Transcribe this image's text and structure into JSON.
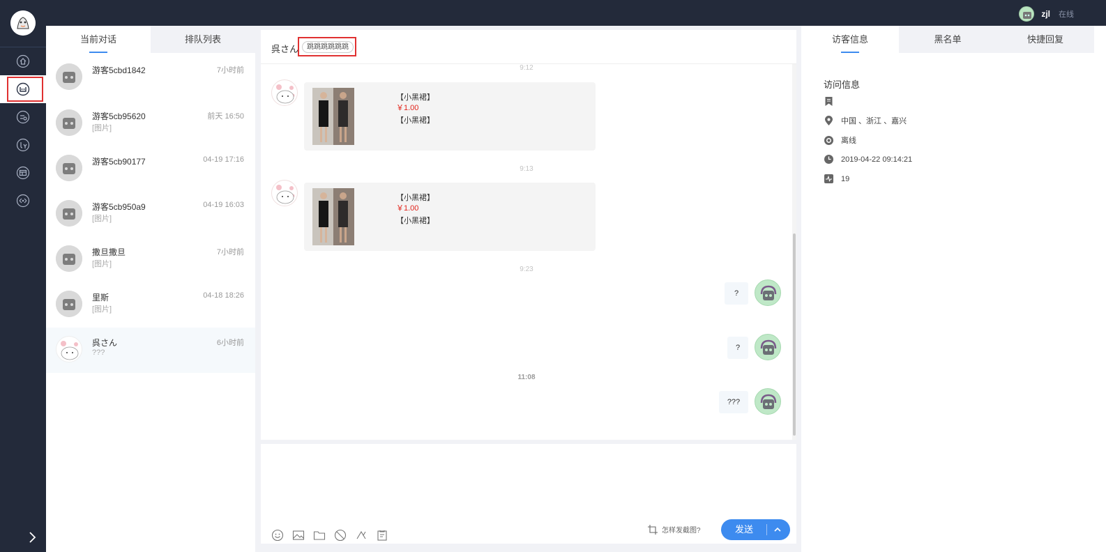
{
  "header": {
    "user_name": "zjl",
    "user_status": "在线"
  },
  "nav": {
    "items": [
      {
        "icon": "home-icon"
      },
      {
        "icon": "conversation-icon"
      },
      {
        "icon": "history-icon"
      },
      {
        "icon": "customers-icon"
      },
      {
        "icon": "store-icon"
      },
      {
        "icon": "settings-icon"
      }
    ],
    "active_index": 1
  },
  "conversation_list": {
    "tabs": [
      {
        "label": "当前对话",
        "active": true
      },
      {
        "label": "排队列表",
        "active": false
      }
    ],
    "items": [
      {
        "name": "游客5cbd1842",
        "time": "7小时前",
        "preview": ""
      },
      {
        "name": "游客5cb95620",
        "time": "前天 16:50",
        "preview": "[图片]"
      },
      {
        "name": "游客5cb90177",
        "time": "04-19 17:16",
        "preview": ""
      },
      {
        "name": "游客5cb950a9",
        "time": "04-19 16:03",
        "preview": "[图片]"
      },
      {
        "name": "撒旦撒旦",
        "time": "7小时前",
        "preview": "[图片]"
      },
      {
        "name": "里斯",
        "time": "04-18 18:26",
        "preview": "[图片]"
      },
      {
        "name": "呉さん",
        "time": "6小时前",
        "preview": "???"
      }
    ],
    "selected_index": 6
  },
  "chat": {
    "visitor_name": "呉さん",
    "visitor_tag": "跳跳跳跳跳跳",
    "messages": [
      {
        "type": "time",
        "text": "9:12"
      },
      {
        "type": "product",
        "name": "【小黑裙】",
        "price": "￥1.00",
        "name2": "【小黑裙】"
      },
      {
        "type": "time",
        "text": "9:13"
      },
      {
        "type": "product",
        "name": "【小黑裙】",
        "price": "￥1.00",
        "name2": "【小黑裙】"
      },
      {
        "type": "time",
        "text": "9:23"
      },
      {
        "type": "mine",
        "text": "?"
      },
      {
        "type": "mine",
        "text": "?"
      },
      {
        "type": "time",
        "text": "11:08"
      },
      {
        "type": "mine",
        "text": "???"
      }
    ]
  },
  "composer": {
    "tools": [
      "emoji-icon",
      "image-icon",
      "folder-icon",
      "rate-icon",
      "transfer-icon",
      "clipboard-icon"
    ],
    "screenshot_hint": "怎样发截图?",
    "send_label": "发送"
  },
  "visitor_info": {
    "tabs": [
      {
        "label": "访客信息",
        "active": true
      },
      {
        "label": "黑名单",
        "active": false
      },
      {
        "label": "快捷回复",
        "active": false
      }
    ],
    "title": "访问信息",
    "rows": [
      {
        "icon": "bookmark-icon",
        "text": ""
      },
      {
        "icon": "location-icon",
        "text": "中国 、浙江 、嘉兴"
      },
      {
        "icon": "online-status-icon",
        "text": "离线"
      },
      {
        "icon": "clock-icon",
        "text": "2019-04-22 09:14:21"
      },
      {
        "icon": "visits-icon",
        "text": "19"
      }
    ]
  }
}
